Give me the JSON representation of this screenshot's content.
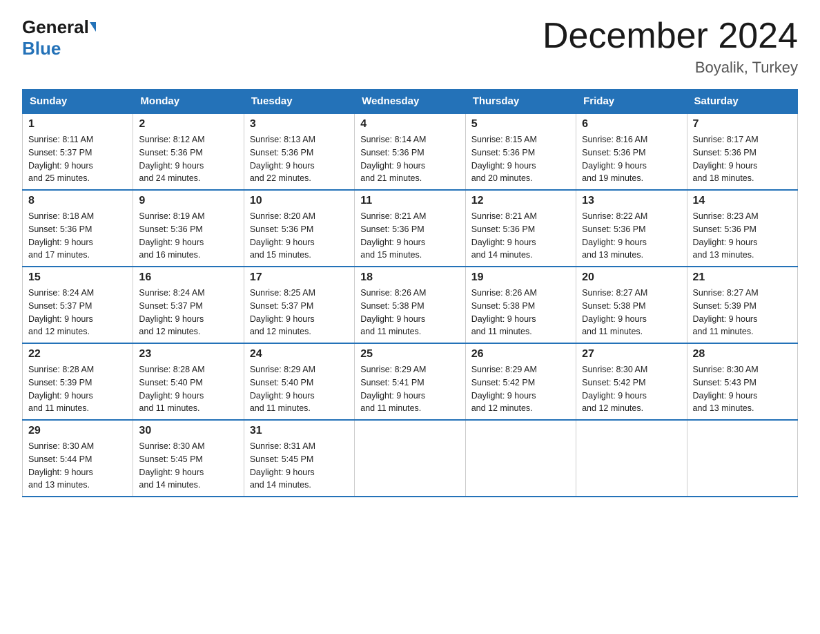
{
  "logo": {
    "word1": "General",
    "triangle": "▶",
    "word2": "Blue"
  },
  "header": {
    "month": "December 2024",
    "location": "Boyalik, Turkey"
  },
  "days_of_week": [
    "Sunday",
    "Monday",
    "Tuesday",
    "Wednesday",
    "Thursday",
    "Friday",
    "Saturday"
  ],
  "weeks": [
    [
      {
        "num": "1",
        "sunrise": "8:11 AM",
        "sunset": "5:37 PM",
        "daylight": "9 hours and 25 minutes."
      },
      {
        "num": "2",
        "sunrise": "8:12 AM",
        "sunset": "5:36 PM",
        "daylight": "9 hours and 24 minutes."
      },
      {
        "num": "3",
        "sunrise": "8:13 AM",
        "sunset": "5:36 PM",
        "daylight": "9 hours and 22 minutes."
      },
      {
        "num": "4",
        "sunrise": "8:14 AM",
        "sunset": "5:36 PM",
        "daylight": "9 hours and 21 minutes."
      },
      {
        "num": "5",
        "sunrise": "8:15 AM",
        "sunset": "5:36 PM",
        "daylight": "9 hours and 20 minutes."
      },
      {
        "num": "6",
        "sunrise": "8:16 AM",
        "sunset": "5:36 PM",
        "daylight": "9 hours and 19 minutes."
      },
      {
        "num": "7",
        "sunrise": "8:17 AM",
        "sunset": "5:36 PM",
        "daylight": "9 hours and 18 minutes."
      }
    ],
    [
      {
        "num": "8",
        "sunrise": "8:18 AM",
        "sunset": "5:36 PM",
        "daylight": "9 hours and 17 minutes."
      },
      {
        "num": "9",
        "sunrise": "8:19 AM",
        "sunset": "5:36 PM",
        "daylight": "9 hours and 16 minutes."
      },
      {
        "num": "10",
        "sunrise": "8:20 AM",
        "sunset": "5:36 PM",
        "daylight": "9 hours and 15 minutes."
      },
      {
        "num": "11",
        "sunrise": "8:21 AM",
        "sunset": "5:36 PM",
        "daylight": "9 hours and 15 minutes."
      },
      {
        "num": "12",
        "sunrise": "8:21 AM",
        "sunset": "5:36 PM",
        "daylight": "9 hours and 14 minutes."
      },
      {
        "num": "13",
        "sunrise": "8:22 AM",
        "sunset": "5:36 PM",
        "daylight": "9 hours and 13 minutes."
      },
      {
        "num": "14",
        "sunrise": "8:23 AM",
        "sunset": "5:36 PM",
        "daylight": "9 hours and 13 minutes."
      }
    ],
    [
      {
        "num": "15",
        "sunrise": "8:24 AM",
        "sunset": "5:37 PM",
        "daylight": "9 hours and 12 minutes."
      },
      {
        "num": "16",
        "sunrise": "8:24 AM",
        "sunset": "5:37 PM",
        "daylight": "9 hours and 12 minutes."
      },
      {
        "num": "17",
        "sunrise": "8:25 AM",
        "sunset": "5:37 PM",
        "daylight": "9 hours and 12 minutes."
      },
      {
        "num": "18",
        "sunrise": "8:26 AM",
        "sunset": "5:38 PM",
        "daylight": "9 hours and 11 minutes."
      },
      {
        "num": "19",
        "sunrise": "8:26 AM",
        "sunset": "5:38 PM",
        "daylight": "9 hours and 11 minutes."
      },
      {
        "num": "20",
        "sunrise": "8:27 AM",
        "sunset": "5:38 PM",
        "daylight": "9 hours and 11 minutes."
      },
      {
        "num": "21",
        "sunrise": "8:27 AM",
        "sunset": "5:39 PM",
        "daylight": "9 hours and 11 minutes."
      }
    ],
    [
      {
        "num": "22",
        "sunrise": "8:28 AM",
        "sunset": "5:39 PM",
        "daylight": "9 hours and 11 minutes."
      },
      {
        "num": "23",
        "sunrise": "8:28 AM",
        "sunset": "5:40 PM",
        "daylight": "9 hours and 11 minutes."
      },
      {
        "num": "24",
        "sunrise": "8:29 AM",
        "sunset": "5:40 PM",
        "daylight": "9 hours and 11 minutes."
      },
      {
        "num": "25",
        "sunrise": "8:29 AM",
        "sunset": "5:41 PM",
        "daylight": "9 hours and 11 minutes."
      },
      {
        "num": "26",
        "sunrise": "8:29 AM",
        "sunset": "5:42 PM",
        "daylight": "9 hours and 12 minutes."
      },
      {
        "num": "27",
        "sunrise": "8:30 AM",
        "sunset": "5:42 PM",
        "daylight": "9 hours and 12 minutes."
      },
      {
        "num": "28",
        "sunrise": "8:30 AM",
        "sunset": "5:43 PM",
        "daylight": "9 hours and 13 minutes."
      }
    ],
    [
      {
        "num": "29",
        "sunrise": "8:30 AM",
        "sunset": "5:44 PM",
        "daylight": "9 hours and 13 minutes."
      },
      {
        "num": "30",
        "sunrise": "8:30 AM",
        "sunset": "5:45 PM",
        "daylight": "9 hours and 14 minutes."
      },
      {
        "num": "31",
        "sunrise": "8:31 AM",
        "sunset": "5:45 PM",
        "daylight": "9 hours and 14 minutes."
      },
      null,
      null,
      null,
      null
    ]
  ],
  "labels": {
    "sunrise": "Sunrise:",
    "sunset": "Sunset:",
    "daylight": "Daylight:"
  }
}
